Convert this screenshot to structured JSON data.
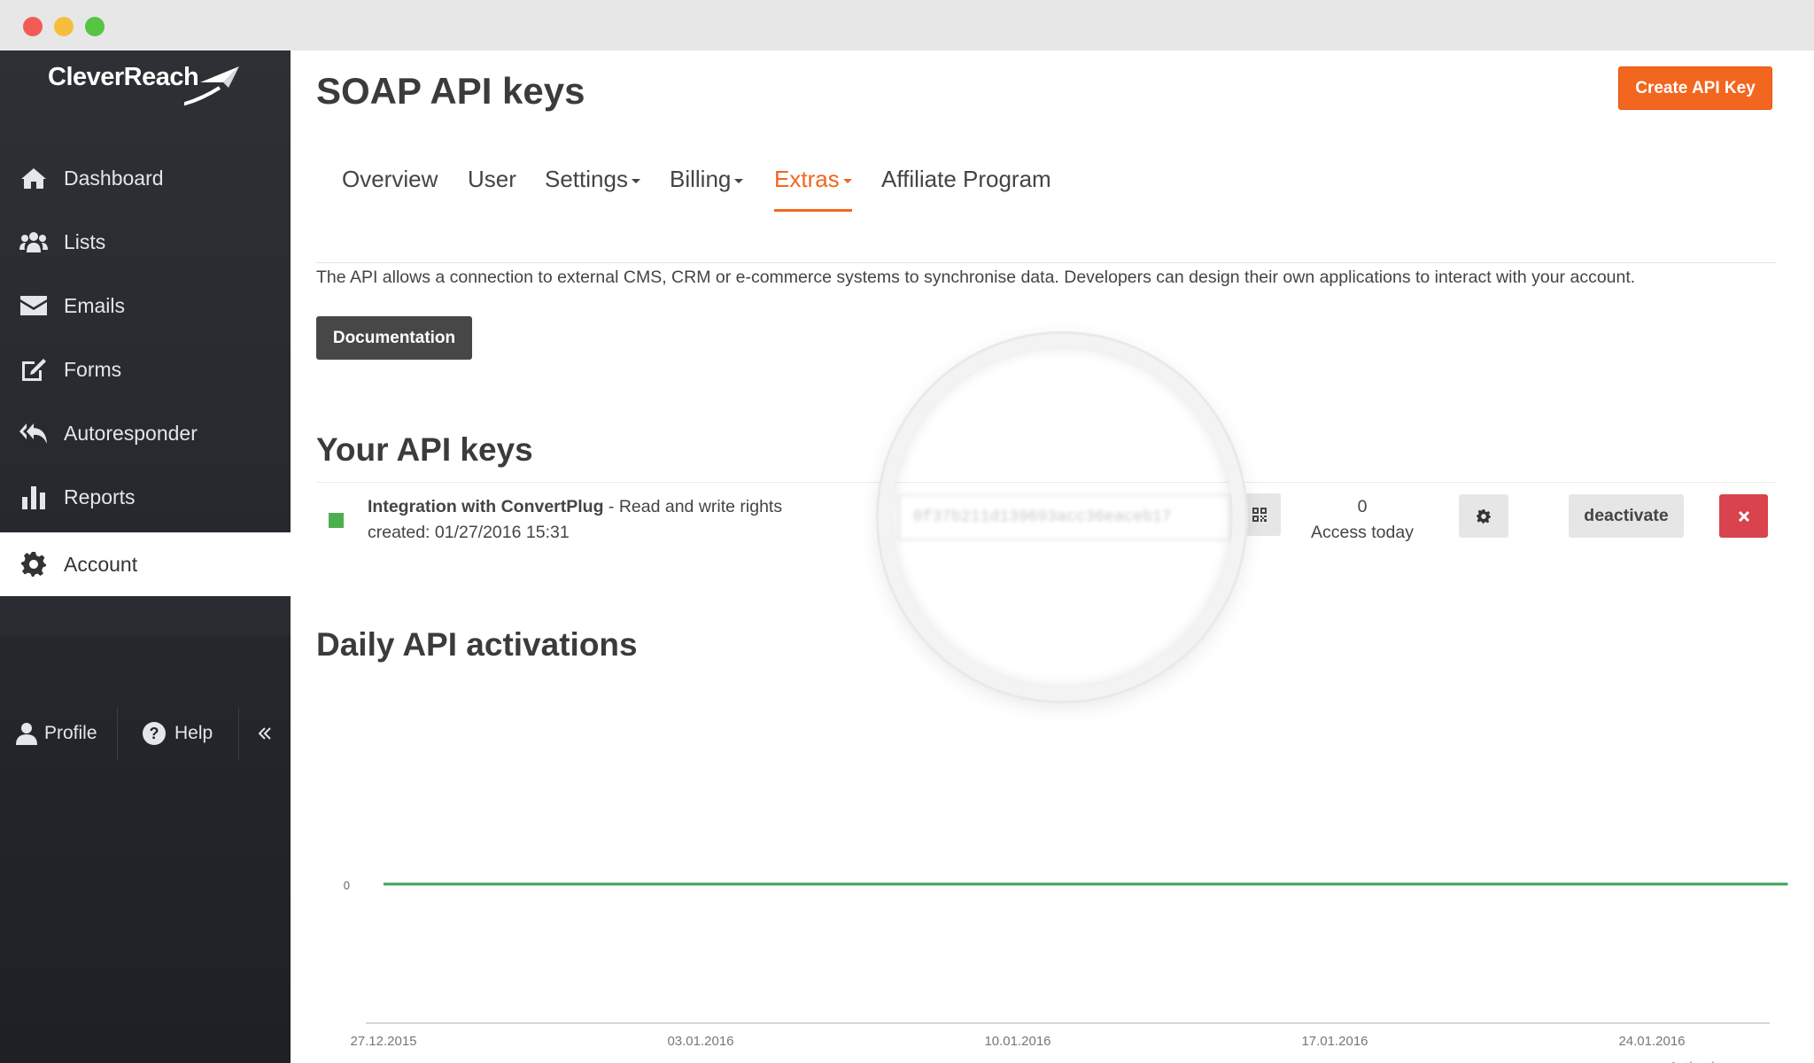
{
  "window": {
    "controls": [
      "close",
      "minimize",
      "maximize"
    ]
  },
  "brand": {
    "name": "CleverReach",
    "accent_color": "#f2661f"
  },
  "sidebar": {
    "items": [
      {
        "label": "Dashboard",
        "icon": "home-icon"
      },
      {
        "label": "Lists",
        "icon": "users-icon"
      },
      {
        "label": "Emails",
        "icon": "envelope-icon"
      },
      {
        "label": "Forms",
        "icon": "edit-icon"
      },
      {
        "label": "Autoresponder",
        "icon": "reply-all-icon"
      },
      {
        "label": "Reports",
        "icon": "bar-chart-icon"
      },
      {
        "label": "Account",
        "icon": "gear-icon",
        "active": true
      }
    ],
    "bottom": {
      "profile_label": "Profile",
      "help_label": "Help",
      "collapse_icon": "double-chevron-left-icon"
    }
  },
  "header": {
    "title": "SOAP API keys",
    "create_button": "Create API Key"
  },
  "tabs": [
    {
      "label": "Overview",
      "dropdown": false
    },
    {
      "label": "User",
      "dropdown": false
    },
    {
      "label": "Settings",
      "dropdown": true
    },
    {
      "label": "Billing",
      "dropdown": true
    },
    {
      "label": "Extras",
      "dropdown": true,
      "active": true
    },
    {
      "label": "Affiliate Program",
      "dropdown": false
    }
  ],
  "intro": {
    "text": "The API allows a connection to external CMS, CRM or e-commerce systems to synchronise data. Developers can design their own applications to interact with your account.",
    "doc_button": "Documentation"
  },
  "api_keys": {
    "heading": "Your API keys",
    "items": [
      {
        "name": "Integration with ConvertPlug",
        "rights": " - Read and write rights",
        "created": "created: 01/27/2016 15:31",
        "key": "0f37b211d139693acc36eaceb17",
        "access_count": "0",
        "access_label": "Access today",
        "deactivate_label": "deactivate",
        "status_color": "#4cae4c"
      }
    ]
  },
  "activations": {
    "heading": "Daily API activations"
  },
  "chart_data": {
    "type": "line",
    "title": "Daily API activations",
    "x_tick_labels": [
      "27.12.2015",
      "03.01.2016",
      "10.01.2016",
      "17.01.2016",
      "24.01.2016"
    ],
    "x_range": [
      "27.12.2015",
      "27.01.2016"
    ],
    "series": [
      {
        "name": "Activations",
        "color": "#3aa35a",
        "x": [
          "27.12.2015",
          "27.01.2016"
        ],
        "y": [
          0,
          0
        ]
      }
    ],
    "y_tick_labels": [
      "0"
    ],
    "legend_position": "bottom-right",
    "grid": false
  }
}
